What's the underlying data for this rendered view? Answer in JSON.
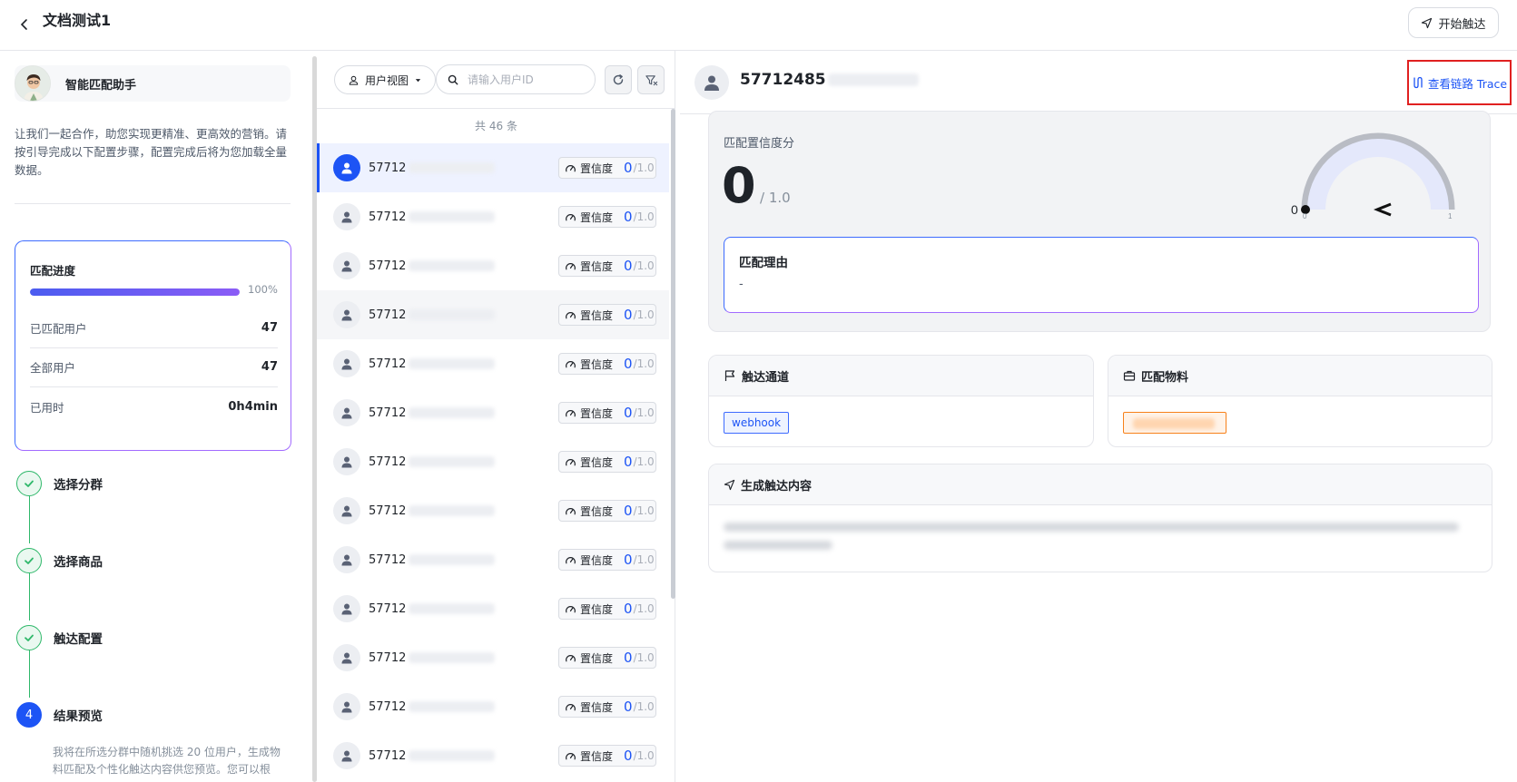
{
  "header": {
    "title": "文档测试1",
    "start_label": "开始触达"
  },
  "assistant": {
    "name": "智能匹配助手",
    "intro": "让我们一起合作，助您实现更精准、更高效的营销。请按引导完成以下配置步骤，配置完成后将为您加载全量数据。"
  },
  "progress": {
    "title": "匹配进度",
    "percent_value": 1.0,
    "percent_label": "100%",
    "stats": [
      {
        "label": "已匹配用户",
        "value": "47"
      },
      {
        "label": "全部用户",
        "value": "47"
      },
      {
        "label": "已用时",
        "value": "0h4min"
      }
    ]
  },
  "steps": [
    {
      "label": "选择分群",
      "state": "done"
    },
    {
      "label": "选择商品",
      "state": "done"
    },
    {
      "label": "触达配置",
      "state": "done"
    },
    {
      "label": "结果预览",
      "state": "current",
      "number": "4",
      "desc": "我将在所选分群中随机挑选 20 位用户，生成物料匹配及个性化触达内容供您预览。您可以根"
    }
  ],
  "list": {
    "view_label": "用户视图",
    "search_placeholder": "请输入用户ID",
    "total_label": "共 46 条",
    "badge_label": "置信度",
    "badge_max": "/1.0",
    "rows": [
      {
        "id_prefix": "57712",
        "score": "0",
        "state": "active"
      },
      {
        "id_prefix": "57712",
        "score": "0",
        "state": ""
      },
      {
        "id_prefix": "57712",
        "score": "0",
        "state": ""
      },
      {
        "id_prefix": "57712",
        "score": "0",
        "state": "hover"
      },
      {
        "id_prefix": "57712",
        "score": "0",
        "state": ""
      },
      {
        "id_prefix": "57712",
        "score": "0",
        "state": ""
      },
      {
        "id_prefix": "57712",
        "score": "0",
        "state": ""
      },
      {
        "id_prefix": "57712",
        "score": "0",
        "state": ""
      },
      {
        "id_prefix": "57712",
        "score": "0",
        "state": ""
      },
      {
        "id_prefix": "57712",
        "score": "0",
        "state": ""
      },
      {
        "id_prefix": "57712",
        "score": "0",
        "state": ""
      },
      {
        "id_prefix": "57712",
        "score": "0",
        "state": ""
      },
      {
        "id_prefix": "57712",
        "score": "0",
        "state": ""
      }
    ]
  },
  "detail": {
    "user_id_prefix": "57712485",
    "trace_label": "查看链路 Trace",
    "score_title": "匹配置信度分",
    "score_value": "0",
    "score_max": "/ 1.0",
    "gauge": {
      "min_label": "0",
      "max_label": "1",
      "value_label": "0",
      "value": 0
    },
    "reason_title": "匹配理由",
    "reason_text": "-",
    "channel_title": "触达通道",
    "channel_tag": "webhook",
    "material_title": "匹配物料",
    "generated_title": "生成触达内容"
  },
  "colors": {
    "primary": "#1d54f5",
    "success": "#2fb86a",
    "highlight": "#e02020"
  }
}
